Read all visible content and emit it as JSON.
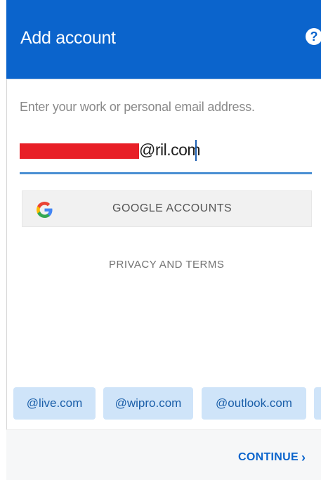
{
  "header": {
    "title": "Add account",
    "help_icon": "question-circle-icon",
    "help_glyph": "?"
  },
  "form": {
    "prompt": "Enter your work or personal email address.",
    "email_visible_suffix": "@ril.com"
  },
  "google": {
    "icon": "google-icon",
    "label": "GOOGLE ACCOUNTS"
  },
  "privacy_label": "PRIVACY AND TERMS",
  "domains": [
    "@live.com",
    "@wipro.com",
    "@outlook.com"
  ],
  "footer": {
    "continue_label": "CONTINUE",
    "continue_icon": "chevron-right-icon",
    "continue_glyph": "›"
  },
  "colors": {
    "header_bg": "#0b64cc",
    "chip_bg": "#cfe4f9",
    "chip_text": "#1b5fa9",
    "redaction": "#e81f27"
  }
}
